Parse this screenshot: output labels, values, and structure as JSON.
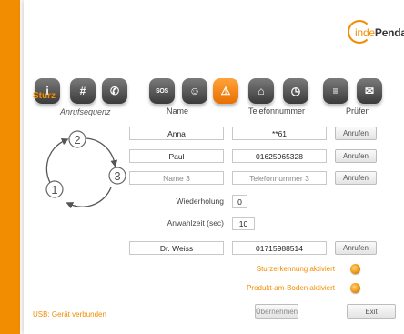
{
  "logo": {
    "text_part1": "inde",
    "text_part2": "Pendan"
  },
  "toolbar": {
    "items": [
      {
        "icon": "info-icon",
        "glyph": "i"
      },
      {
        "icon": "keypad-icon",
        "glyph": "#"
      },
      {
        "icon": "phone-icon",
        "glyph": "✆"
      },
      {
        "icon": "sos-icon",
        "glyph": "SOS"
      },
      {
        "icon": "contacts-icon",
        "glyph": "☺"
      },
      {
        "icon": "fall-icon",
        "glyph": "⚠"
      },
      {
        "icon": "home-icon",
        "glyph": "⌂"
      },
      {
        "icon": "alarm-clock-icon",
        "glyph": "◷"
      },
      {
        "icon": "settings-icon",
        "glyph": "≡"
      },
      {
        "icon": "message-icon",
        "glyph": "✉"
      }
    ],
    "active_index": 5
  },
  "section": {
    "title": "Sturz"
  },
  "table": {
    "headers": {
      "sequence": "Anrufsequenz",
      "name": "Name",
      "phone": "Telefonnummer",
      "test": "Prüfen"
    },
    "rows": [
      {
        "name": "Anna",
        "phone": "**61",
        "button": "Anrufen"
      },
      {
        "name": "Paul",
        "phone": "01625965328",
        "button": "Anrufen"
      },
      {
        "name": "Name 3",
        "phone": "Telefonnummer 3",
        "button": "Anrufen"
      }
    ],
    "sequence_numbers": [
      "1",
      "2",
      "3"
    ]
  },
  "repeat": {
    "label": "Wiederholung",
    "value": "0"
  },
  "dial_time": {
    "label": "Anwahlzeit (sec)",
    "value": "10"
  },
  "doctor": {
    "name": "Dr. Weiss",
    "phone": "01715988514",
    "button": "Anrufen"
  },
  "options": {
    "fall_detection": "Sturzerkennung aktiviert",
    "product_on_floor": "Produkt-am-Boden aktiviert"
  },
  "actions": {
    "apply": "Übernehmen",
    "exit": "Exit"
  },
  "status": {
    "usb": "USB: Gerät verbunden"
  },
  "colors": {
    "accent": "#f28c00",
    "icon_gray": "#5a5a5a"
  }
}
